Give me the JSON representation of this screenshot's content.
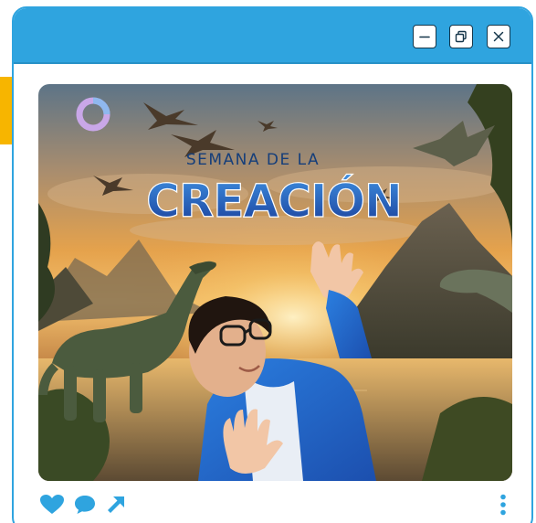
{
  "window": {
    "accent_color": "#2fa4df",
    "border_color": "#2fa4df",
    "controls": [
      {
        "name": "minimize",
        "icon": "minimize-icon"
      },
      {
        "name": "restore",
        "icon": "restore-icon"
      },
      {
        "name": "close",
        "icon": "close-icon"
      }
    ]
  },
  "post": {
    "image": {
      "overline": "SEMANA DE LA",
      "headline": "CREACIÓN",
      "logo_color": "#c9a7e8"
    },
    "actions": {
      "icon_color": "#2fa4df",
      "like_icon": "heart-icon",
      "comment_icon": "comment-icon",
      "share_icon": "share-arrow-icon",
      "more_icon": "more-vertical-icon"
    }
  },
  "colors": {
    "side_accent": "#f7b500"
  }
}
